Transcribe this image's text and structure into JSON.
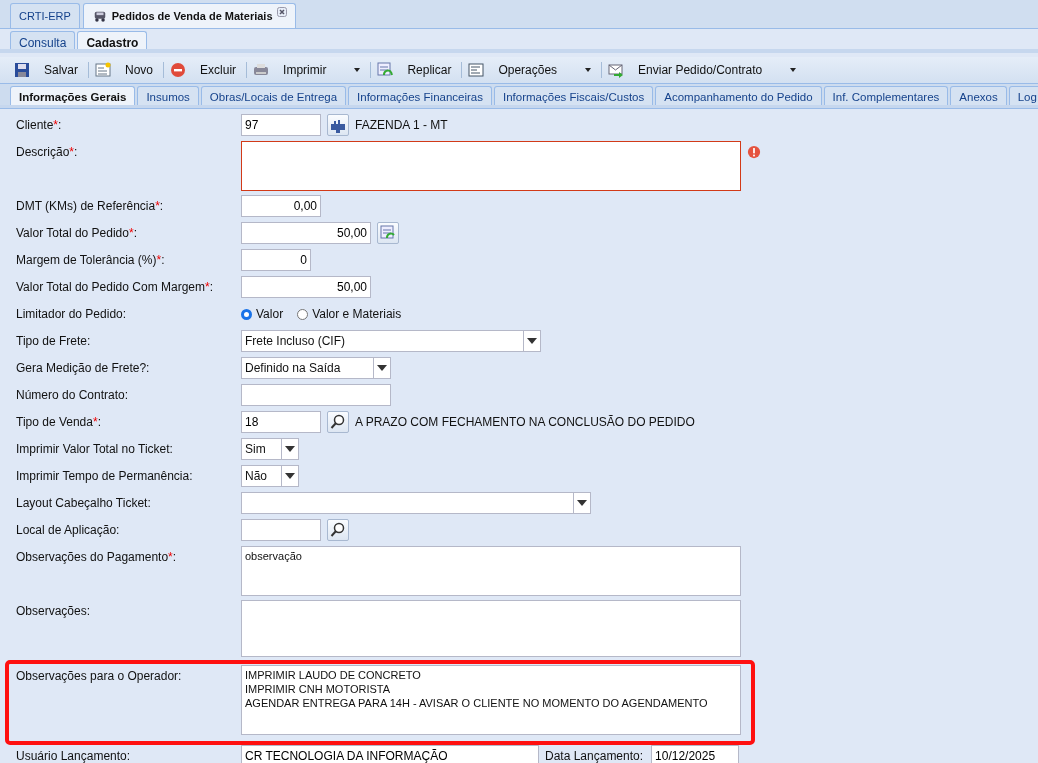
{
  "app_tabs": [
    {
      "label": "CRTI-ERP",
      "selected": false,
      "closable": false
    },
    {
      "label": "Pedidos de Venda de Materiais",
      "selected": true,
      "closable": true
    }
  ],
  "mode_tabs": [
    {
      "label": "Consulta",
      "selected": false
    },
    {
      "label": "Cadastro",
      "selected": true
    }
  ],
  "toolbar": [
    {
      "label": "Salvar",
      "dropdown": false
    },
    {
      "label": "Novo",
      "dropdown": false
    },
    {
      "label": "Excluir",
      "dropdown": false
    },
    {
      "label": "Imprimir",
      "dropdown": true
    },
    {
      "label": "Replicar",
      "dropdown": false
    },
    {
      "label": "Operações",
      "dropdown": true
    },
    {
      "label": "Enviar Pedido/Contrato",
      "dropdown": true
    }
  ],
  "section_tabs": [
    {
      "label": "Informações Gerais",
      "selected": true
    },
    {
      "label": "Insumos",
      "selected": false
    },
    {
      "label": "Obras/Locais de Entrega",
      "selected": false
    },
    {
      "label": "Informações Financeiras",
      "selected": false
    },
    {
      "label": "Informações Fiscais/Custos",
      "selected": false
    },
    {
      "label": "Acompanhamento do Pedido",
      "selected": false
    },
    {
      "label": "Inf. Complementares",
      "selected": false
    },
    {
      "label": "Anexos",
      "selected": false
    },
    {
      "label": "Log",
      "selected": false
    }
  ],
  "form": {
    "rows": [
      {
        "kind": "lookup",
        "label": "Cliente",
        "required_mark": "*",
        "suffix": ":",
        "value": "97",
        "button": {
          "kind": "building"
        },
        "description": "FAZENDA 1 - MT"
      },
      {
        "kind": "textarea",
        "label": "Descrição",
        "required_mark": "*",
        "suffix": ":",
        "value": "",
        "invalid": true
      },
      {
        "kind": "number",
        "label": "DMT (KMs) de Referência",
        "required_mark": "*",
        "suffix": ":",
        "value": "0,00"
      },
      {
        "kind": "number",
        "label": "Valor Total do Pedido",
        "required_mark": "*",
        "suffix": ":",
        "value": "50,00",
        "button": {
          "kind": "refresh"
        }
      },
      {
        "kind": "number",
        "label": "Margem de Tolerância (%)",
        "required_mark": "*",
        "suffix": ":",
        "value": "0"
      },
      {
        "kind": "number",
        "label": "Valor Total do Pedido Com Margem",
        "required_mark": "*",
        "suffix": ":",
        "value": "50,00"
      },
      {
        "kind": "radio",
        "label": "Limitador do Pedido",
        "suffix": ":",
        "options": [
          {
            "label": "Valor",
            "selected": true
          },
          {
            "label": "Valor e Materiais",
            "selected": false
          }
        ]
      },
      {
        "kind": "select",
        "label": "Tipo de Frete",
        "suffix": ":",
        "value": "Frete Incluso (CIF)"
      },
      {
        "kind": "select",
        "label": "Gera Medição de Frete?",
        "suffix": ":",
        "value": "Definido na Saída"
      },
      {
        "kind": "text",
        "label": "Número do Contrato",
        "suffix": ":",
        "value": ""
      },
      {
        "kind": "lookup",
        "label": "Tipo de Venda",
        "required_mark": "*",
        "suffix": ":",
        "value": "18",
        "button": {
          "kind": "search"
        },
        "description": "A PRAZO COM FECHAMENTO NA CONCLUSÃO DO PEDIDO"
      },
      {
        "kind": "select",
        "label": "Imprimir Valor Total no Ticket",
        "suffix": ":",
        "value": "Sim"
      },
      {
        "kind": "select",
        "label": "Imprimir Tempo de Permanência",
        "suffix": ":",
        "value": "Não"
      },
      {
        "kind": "select",
        "label": "Layout Cabeçalho Ticket",
        "suffix": ":",
        "value": ""
      },
      {
        "kind": "lookup",
        "label": "Local de Aplicação",
        "suffix": ":",
        "value": "",
        "button": {
          "kind": "search"
        }
      },
      {
        "kind": "textarea",
        "label": "Observações do Pagamento",
        "required_mark": "*",
        "suffix": ":",
        "value": "observação",
        "invalid": false
      },
      {
        "kind": "textarea",
        "label": "Observações",
        "suffix": ":",
        "value": "",
        "invalid": false
      },
      {
        "kind": "textarea",
        "label": "Observações para o Operador",
        "suffix": ":",
        "value": "IMPRIMIR LAUDO DE CONCRETO\nIMPRIMIR CNH MOTORISTA\nAGENDAR ENTREGA PARA 14H - AVISAR O CLIENTE NO MOMENTO DO AGENDAMENTO",
        "invalid": false,
        "highlighted": true
      }
    ],
    "footer": [
      {
        "label": "Usuário Lançamento:",
        "value": "CR TECNOLOGIA DA INFORMAÇÃO"
      },
      {
        "label": "Data Lançamento:",
        "value": "10/12/2025"
      }
    ]
  }
}
